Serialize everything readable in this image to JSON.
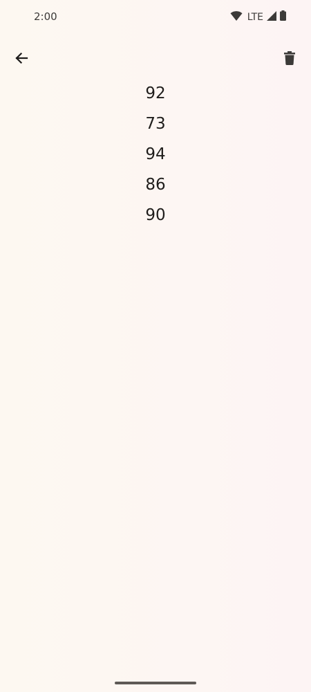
{
  "status_bar": {
    "time": "2:00",
    "network": "LTE",
    "icons": [
      "wifi-icon",
      "signal-icon",
      "battery-icon"
    ]
  },
  "top_bar": {
    "back_icon": "arrow-left-icon",
    "delete_icon": "trash-icon"
  },
  "scores": [
    "92",
    "73",
    "94",
    "86",
    "90"
  ],
  "colors": {
    "background": "#fdf7f2",
    "text": "#1f1d1b",
    "icon": "#3c3a38"
  }
}
